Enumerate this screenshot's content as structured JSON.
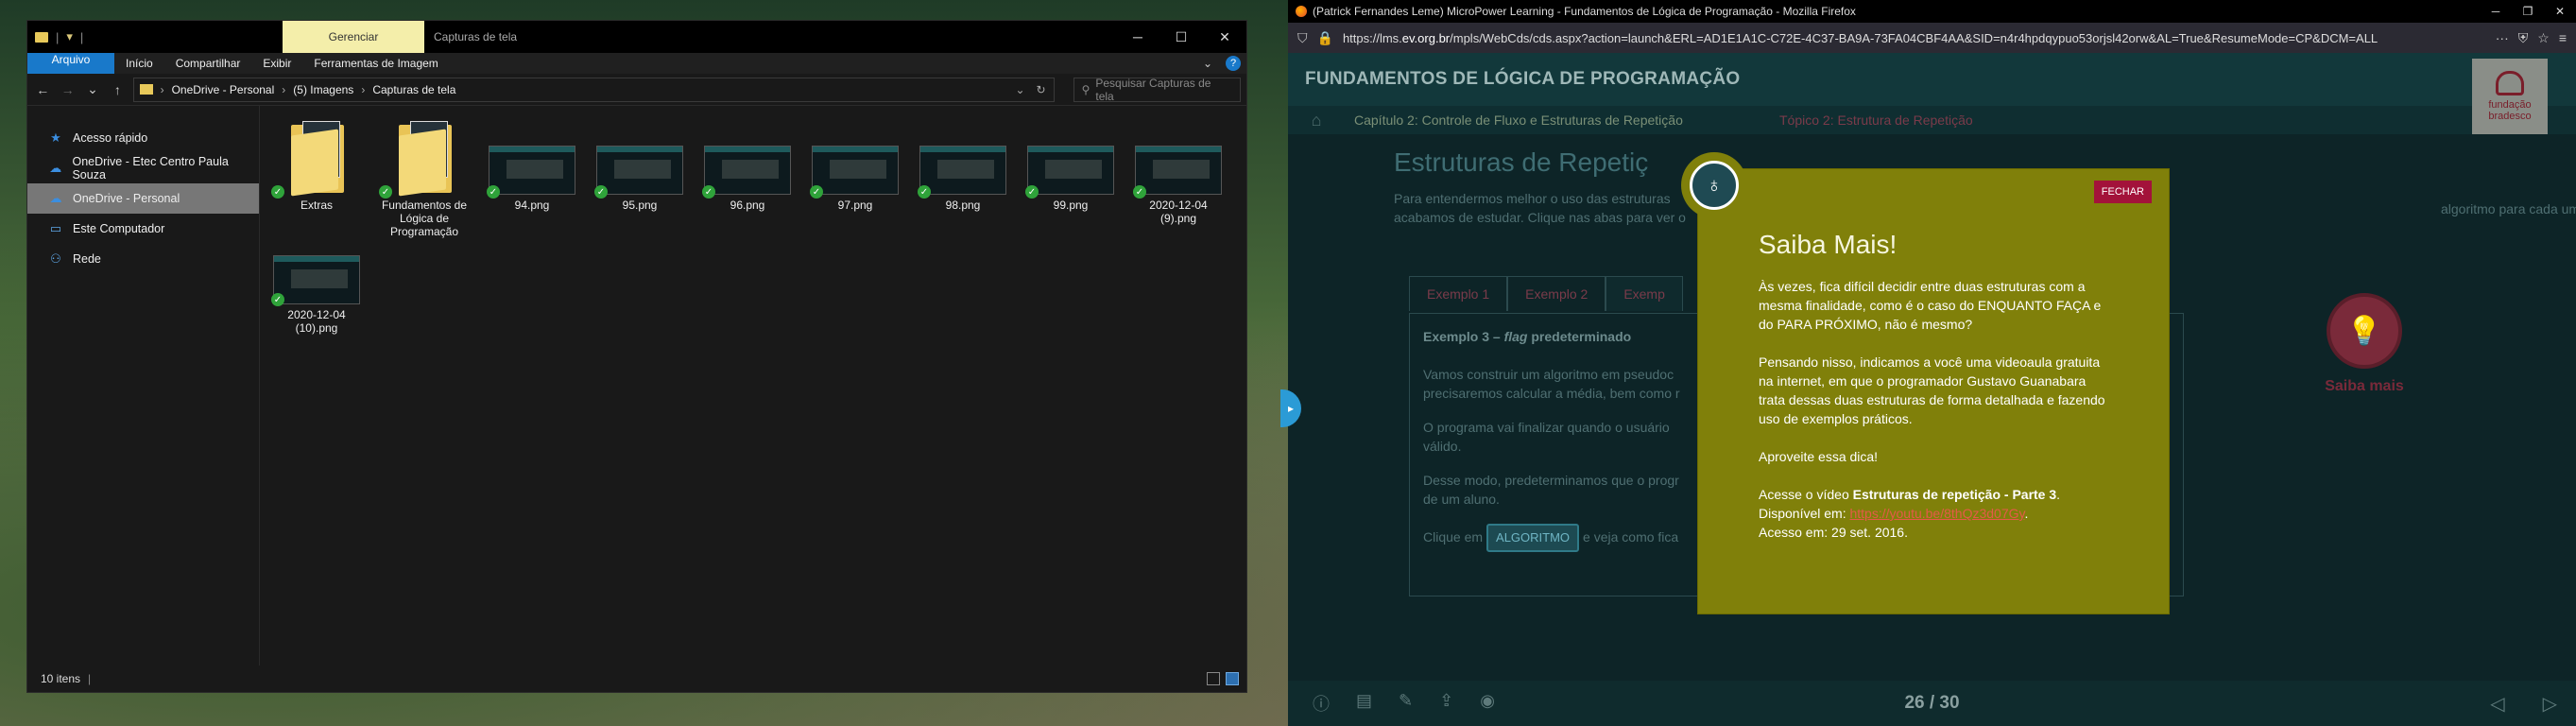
{
  "explorer": {
    "ribbon_group": "Gerenciar",
    "window_title": "Capturas de tela",
    "ribbon_tabs": [
      "Arquivo",
      "Início",
      "Compartilhar",
      "Exibir",
      "Ferramentas de Imagem"
    ],
    "breadcrumb": [
      "OneDrive - Personal",
      "(5) Imagens",
      "Capturas de tela"
    ],
    "search_placeholder": "Pesquisar Capturas de tela",
    "nav": [
      {
        "label": "Acesso rápido",
        "icon": "star-icon"
      },
      {
        "label": "OneDrive - Etec Centro Paula Souza",
        "icon": "cloud-icon"
      },
      {
        "label": "OneDrive - Personal",
        "icon": "cloud-icon"
      },
      {
        "label": "Este Computador",
        "icon": "computer-icon"
      },
      {
        "label": "Rede",
        "icon": "network-icon"
      }
    ],
    "files": [
      {
        "name": "Extras",
        "type": "folder"
      },
      {
        "name": "Fundamentos de Lógica de Programação",
        "type": "folder"
      },
      {
        "name": "94.png",
        "type": "image"
      },
      {
        "name": "95.png",
        "type": "image"
      },
      {
        "name": "96.png",
        "type": "image"
      },
      {
        "name": "97.png",
        "type": "image"
      },
      {
        "name": "98.png",
        "type": "image"
      },
      {
        "name": "99.png",
        "type": "image"
      },
      {
        "name": "2020-12-04 (9).png",
        "type": "image"
      },
      {
        "name": "2020-12-04 (10).png",
        "type": "image"
      }
    ],
    "status": "10 itens"
  },
  "firefox": {
    "title": "(Patrick Fernandes Leme) MicroPower Learning - Fundamentos de Lógica de Programação - Mozilla Firefox",
    "url_prefix": "https://lms.",
    "url_domain": "ev.org.br",
    "url_rest": "/mpls/WebCds/cds.aspx?action=launch&ERL=AD1E1A1C-C72E-4C37-BA9A-73FA04CBF4AA&SID=n4r4hpdqypuo53orjsl42orw&AL=True&ResumeMode=CP&DCM=ALL"
  },
  "course": {
    "header": "FUNDAMENTOS DE LÓGICA DE PROGRAMAÇÃO",
    "crumb_chapter": "Capítulo 2: Controle de Fluxo e Estruturas de Repetição",
    "crumb_topic": "Tópico 2: Estrutura de Repetição",
    "logo_text": "fundação bradesco",
    "heading": "Estruturas de Repetiç",
    "intro_left": "Para entendermos melhor o uso das estruturas",
    "intro_left2": "acabamos de estudar. Clique nas abas para ver o",
    "intro_right": "algoritmo para cada uma das estruturas que",
    "tabs": [
      "Exemplo 1",
      "Exemplo 2",
      "Exemp"
    ],
    "panel_title_prefix": "Exemplo 3 – ",
    "panel_title_flag": "flag",
    "panel_title_suffix": " predeterminado",
    "panel_p1a": "Vamos construir um algoritmo em pseudoc",
    "panel_p1b": "precisaremos calcular a média, bem como r",
    "panel_p2a": "O programa vai finalizar quando o usuário",
    "panel_p2b": "válido.",
    "panel_p3a": "Desse modo, predeterminamos que o progr",
    "panel_p3b": "de um aluno.",
    "panel_click_prefix": "Clique em",
    "algo_button": "ALGORITMO",
    "panel_click_suffix": "e veja como fica",
    "saiba_label": "Saiba mais",
    "page_indicator": "26 / 30"
  },
  "modal": {
    "close": "FECHAR",
    "title": "Saiba Mais!",
    "p1": "Às vezes, fica difícil decidir entre duas estruturas com a mesma finalidade, como é o caso do ENQUANTO FAÇA e do PARA PRÓXIMO, não é mesmo?",
    "p2": "Pensando nisso, indicamos a você uma videoaula gratuita na internet, em que o programador Gustavo Guanabara trata dessas duas estruturas de forma detalhada e fazendo uso de exemplos práticos.",
    "p3": "Aproveite essa dica!",
    "ref_prefix": "Acesse o vídeo ",
    "ref_bold": "Estruturas de repetição - Parte 3",
    "ref_suffix": ".",
    "available_prefix": "Disponível em: ",
    "link": "https://youtu.be/8thQz3d07Gy",
    "accessed": "Acesso em: 29 set. 2016."
  }
}
